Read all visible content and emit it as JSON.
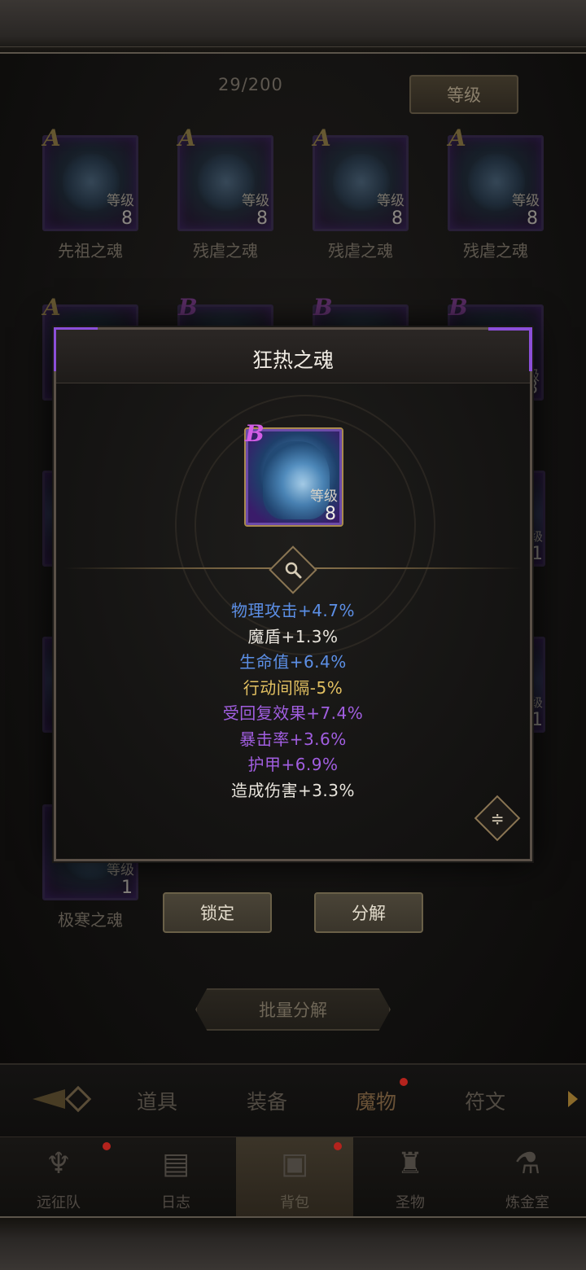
{
  "header": {
    "count": "29/200",
    "sort_label": "等级"
  },
  "grid": {
    "row1": [
      {
        "rank": "A",
        "level_label": "等级",
        "level": "8",
        "name": "先祖之魂"
      },
      {
        "rank": "A",
        "level_label": "等级",
        "level": "8",
        "name": "残虐之魂"
      },
      {
        "rank": "A",
        "level_label": "等级",
        "level": "8",
        "name": "残虐之魂"
      },
      {
        "rank": "A",
        "level_label": "等级",
        "level": "8",
        "name": "残虐之魂"
      }
    ],
    "row2_ranks": [
      "A",
      "B",
      "B",
      "B"
    ],
    "partial_right": [
      {
        "level_label": "级",
        "level": "8"
      },
      {
        "level_label": "级",
        "level": "1"
      },
      {
        "level_label": "级",
        "level": "1"
      }
    ],
    "last": {
      "level_label": "等级",
      "level": "1",
      "name": "极寒之魂"
    }
  },
  "modal": {
    "title": "狂热之魂",
    "item": {
      "rank": "B",
      "level_label": "等级",
      "level": "8"
    },
    "stats": [
      {
        "text": "物理攻击+4.7%",
        "color": "#5c8fe6"
      },
      {
        "text": "魔盾+1.3%",
        "color": "#e8e4dc"
      },
      {
        "text": "生命值+6.4%",
        "color": "#5c8fe6"
      },
      {
        "text": "行动间隔-5%",
        "color": "#e2c061"
      },
      {
        "text": "受回复效果+7.4%",
        "color": "#a15ee0"
      },
      {
        "text": "暴击率+3.6%",
        "color": "#a15ee0"
      },
      {
        "text": "护甲+6.9%",
        "color": "#a15ee0"
      },
      {
        "text": "造成伤害+3.3%",
        "color": "#e8e4dc"
      }
    ],
    "expand_icon": "double-chevron-icon"
  },
  "actions": {
    "lock_label": "锁定",
    "decompose_label": "分解",
    "batch_label": "批量分解"
  },
  "tabs": {
    "items": [
      "道具",
      "装备",
      "魔物",
      "符文"
    ],
    "active": "魔物"
  },
  "nav": {
    "items": [
      "远征队",
      "日志",
      "背包",
      "圣物",
      "炼金室"
    ],
    "active": "背包"
  },
  "colors": {
    "accent_purple": "#8b4fd8",
    "notification_red": "#b4231d",
    "gold_border": "#8a7553"
  }
}
